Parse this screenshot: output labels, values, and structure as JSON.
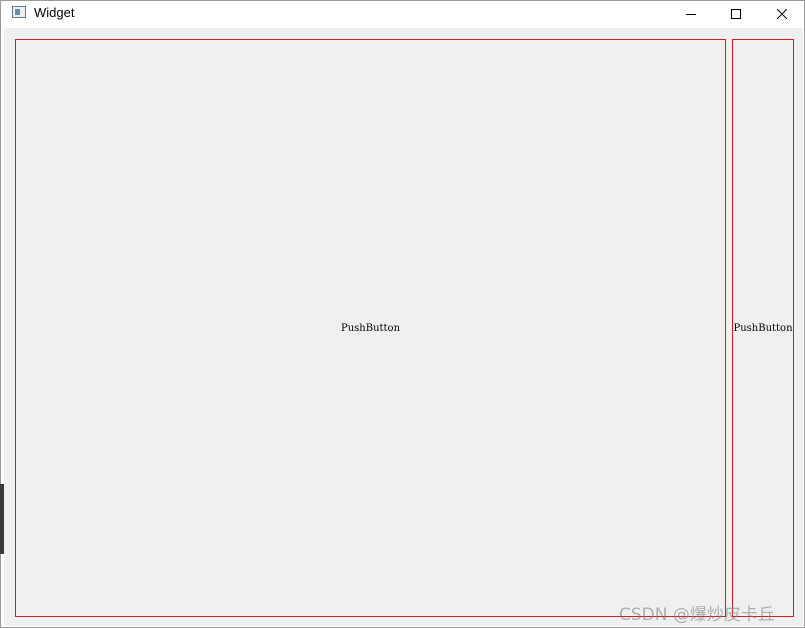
{
  "window": {
    "title": "Widget",
    "controls": {
      "minimize_icon": "minimize-icon",
      "maximize_icon": "maximize-icon",
      "close_icon": "close-icon"
    }
  },
  "buttons": {
    "left_label": "PushButton",
    "right_label": "PushButton",
    "border_color": "#cc1f1f"
  },
  "watermark": {
    "text": "CSDN @爆炒皮卡丘"
  }
}
